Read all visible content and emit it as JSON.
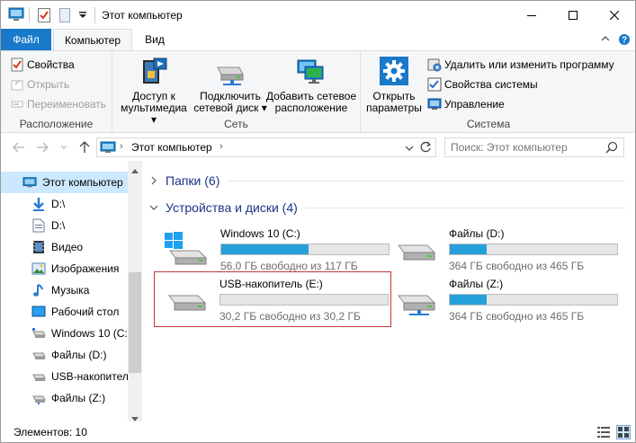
{
  "window": {
    "title": "Этот компьютер"
  },
  "ribbon": {
    "tabs": {
      "file": "Файл",
      "computer": "Компьютер",
      "view": "Вид"
    },
    "location": {
      "label": "Расположение",
      "properties": "Свойства",
      "open": "Открыть",
      "rename": "Переименовать"
    },
    "network": {
      "label": "Сеть",
      "media_line1": "Доступ к",
      "media_line2": "мультимедиа",
      "map_line1": "Подключить",
      "map_line2": "сетевой диск",
      "add_line1": "Добавить сетевое",
      "add_line2": "расположение"
    },
    "system": {
      "label": "Система",
      "settings_line1": "Открыть",
      "settings_line2": "параметры",
      "uninstall": "Удалить или изменить программу",
      "sysprops": "Свойства системы",
      "manage": "Управление"
    }
  },
  "address": {
    "path": "Этот компьютер",
    "search_placeholder": "Поиск: Этот компьютер"
  },
  "nav": {
    "items": [
      {
        "label": "Этот компьютер",
        "icon": "computer-icon"
      },
      {
        "label": "D:\\",
        "icon": "download-arrow-icon"
      },
      {
        "label": "D:\\",
        "icon": "document-icon"
      },
      {
        "label": "Видео",
        "icon": "video-icon"
      },
      {
        "label": "Изображения",
        "icon": "pictures-icon"
      },
      {
        "label": "Музыка",
        "icon": "music-icon"
      },
      {
        "label": "Рабочий стол",
        "icon": "desktop-icon"
      },
      {
        "label": "Windows 10 (C:)",
        "icon": "drive-icon"
      },
      {
        "label": "Файлы (D:)",
        "icon": "drive-icon"
      },
      {
        "label": "USB-накопитель",
        "icon": "drive-icon"
      },
      {
        "label": "Файлы (Z:)",
        "icon": "drive-icon"
      }
    ]
  },
  "content": {
    "folders_header": "Папки (6)",
    "devices_header": "Устройства и диски (4)",
    "drives": [
      {
        "name": "Windows 10 (C:)",
        "free": "56,0 ГБ свободно из 117 ГБ",
        "used_fraction": 0.52,
        "icon": "windows-drive-icon"
      },
      {
        "name": "Файлы (D:)",
        "free": "364 ГБ свободно из 465 ГБ",
        "used_fraction": 0.22,
        "icon": "hdd-icon"
      },
      {
        "name": "USB-накопитель (E:)",
        "free": "30,2 ГБ свободно из 30,2 ГБ",
        "used_fraction": 0.0,
        "icon": "usb-drive-icon"
      },
      {
        "name": "Файлы (Z:)",
        "free": "364 ГБ свободно из 465 ГБ",
        "used_fraction": 0.22,
        "icon": "network-drive-icon"
      }
    ]
  },
  "status": {
    "items_count": "Элементов: 10"
  },
  "colors": {
    "accent": "#1979ca",
    "bar_fill": "#26a0da",
    "selection": "#cce8ff",
    "highlight_border": "#c83535"
  }
}
